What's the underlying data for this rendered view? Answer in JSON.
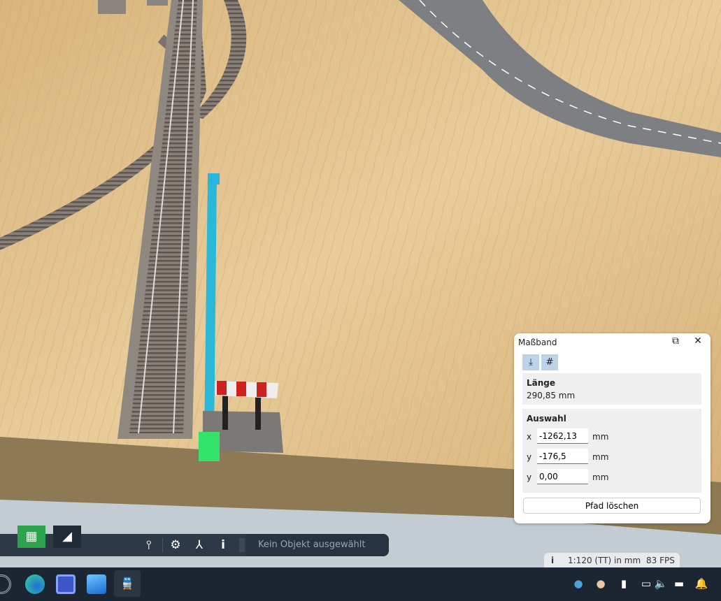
{
  "panel": {
    "title": "Maßband",
    "popout_icon": "popout-icon",
    "close_icon": "close-icon",
    "tools": [
      {
        "icon": "snap-to-ground-icon"
      },
      {
        "icon": "track-icon"
      }
    ],
    "length": {
      "heading": "Länge",
      "value": "290,85 mm"
    },
    "selection": {
      "heading": "Auswahl",
      "rows": [
        {
          "label": "x",
          "value": "-1262,13",
          "unit": "mm"
        },
        {
          "label": "y",
          "value": "-176,5",
          "unit": "mm"
        },
        {
          "label": "y",
          "value": "0,00",
          "unit": "mm"
        }
      ]
    },
    "clear_path": "Pfad löschen"
  },
  "toolbar": {
    "status": "Kein Objekt ausgewählt"
  },
  "infobar": {
    "scale": "1:120 (TT) in mm",
    "fps": "83 FPS"
  },
  "colors": {
    "accent": "#2aa34a",
    "tape": "#2ab8d8",
    "panel_tool": "#bcd3ea"
  }
}
